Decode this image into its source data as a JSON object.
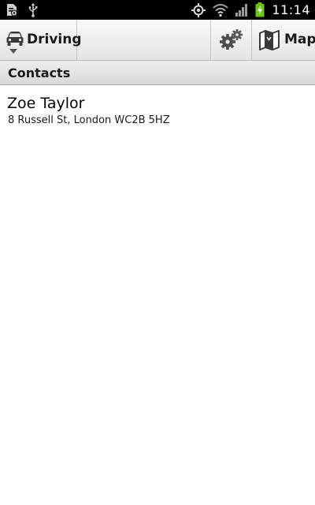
{
  "status_bar": {
    "time": "11:14",
    "icons_left": [
      "sd-card-settings-icon",
      "usb-icon"
    ],
    "icons_right": [
      "gps-icon",
      "wifi-icon",
      "signal-icon",
      "battery-charging-icon"
    ],
    "battery_color": "#6cc21a"
  },
  "action_bar": {
    "mode_label": "Driving",
    "mode_icon": "car-icon",
    "settings_icon": "settings-gears-icon",
    "map_label": "Map",
    "map_icon": "map-icon"
  },
  "section": {
    "title": "Contacts"
  },
  "contacts": [
    {
      "name": "Zoe Taylor",
      "address": "8 Russell St, London WC2B 5HZ"
    }
  ]
}
